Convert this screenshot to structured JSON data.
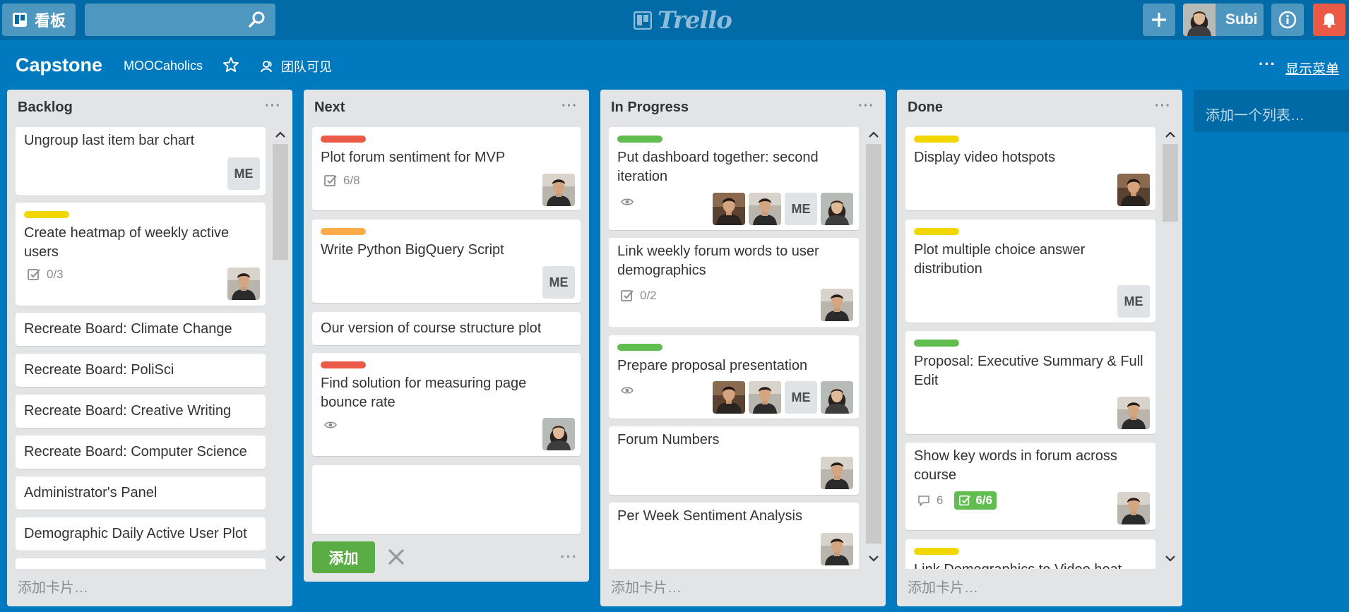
{
  "header": {
    "boards_label": "看板",
    "search_placeholder": "",
    "logo_text": "Trello",
    "user_name": "Subi"
  },
  "board": {
    "title": "Capstone",
    "team": "MOOCaholics",
    "visibility": "团队可见",
    "show_menu": "显示菜单"
  },
  "lists": [
    {
      "title": "Backlog",
      "footer": "添加卡片…",
      "cards": [
        {
          "title": "Ungroup last item bar chart",
          "members": [
            "ME"
          ]
        },
        {
          "title": "Create heatmap of weekly active users",
          "label": "yellow",
          "checklist": "0/3",
          "members": [
            "man"
          ]
        },
        {
          "title": "Recreate Board: Climate Change"
        },
        {
          "title": "Recreate Board: PoliSci"
        },
        {
          "title": "Recreate Board: Creative Writing"
        },
        {
          "title": "Recreate Board: Computer Science"
        },
        {
          "title": "Administrator's Panel"
        },
        {
          "title": "Demographic Daily Active User Plot"
        }
      ]
    },
    {
      "title": "Next",
      "add_button": "添加",
      "cards": [
        {
          "title": "Plot forum sentiment for MVP",
          "label": "red",
          "checklist": "6/8",
          "members": [
            "man"
          ]
        },
        {
          "title": "Write Python BigQuery Script",
          "label": "orange",
          "members": [
            "ME"
          ]
        },
        {
          "title": "Our version of course structure plot"
        },
        {
          "title": "Find solution for measuring page bounce rate",
          "label": "red",
          "watch": true,
          "members": [
            "woman"
          ]
        }
      ]
    },
    {
      "title": "In Progress",
      "footer": "添加卡片…",
      "cards": [
        {
          "title": "Put dashboard together: second iteration",
          "label": "green",
          "watch": true,
          "members": [
            "man2",
            "man",
            "ME",
            "woman"
          ]
        },
        {
          "title": "Link weekly forum words to user demographics",
          "checklist": "0/2",
          "members": [
            "man"
          ]
        },
        {
          "title": "Prepare proposal presentation",
          "label": "green",
          "watch": true,
          "members": [
            "man2",
            "man",
            "ME",
            "woman"
          ]
        },
        {
          "title": "Forum Numbers",
          "members": [
            "man"
          ]
        },
        {
          "title": "Per Week Sentiment Analysis",
          "members": [
            "man"
          ]
        }
      ]
    },
    {
      "title": "Done",
      "footer": "添加卡片…",
      "cards": [
        {
          "title": "Display video hotspots",
          "label": "yellow",
          "members": [
            "man2"
          ]
        },
        {
          "title": "Plot multiple choice answer distribution",
          "label": "yellow",
          "members": [
            "ME"
          ]
        },
        {
          "title": "Proposal: Executive Summary & Full Edit",
          "label": "green",
          "members": [
            "man"
          ]
        },
        {
          "title": "Show key words in forum across course",
          "comments": "6",
          "checklist": "6/6",
          "members": [
            "man"
          ]
        },
        {
          "title": "Link Demographics to Video heat",
          "label": "yellow"
        }
      ]
    }
  ],
  "add_list_label": "添加一个列表…",
  "member_initials": "ME",
  "colors": {
    "board_bg": "#0079bf",
    "header_bg": "#026aa7",
    "label_red": "#eb5a46",
    "label_orange": "#ffab4a",
    "label_yellow": "#f2d600",
    "label_green": "#61bd4f",
    "add_button": "#5aac44",
    "notification": "#eb5a46"
  }
}
